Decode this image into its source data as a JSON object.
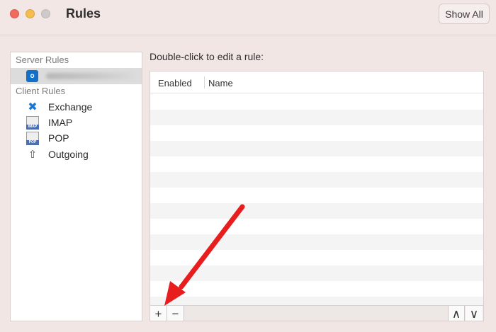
{
  "window": {
    "title": "Rules",
    "show_all_label": "Show All"
  },
  "sidebar": {
    "server_rules_label": "Server Rules",
    "client_rules_label": "Client Rules",
    "client_items": [
      {
        "label": "Exchange",
        "icon": "exchange-icon"
      },
      {
        "label": "IMAP",
        "icon": "imap-icon"
      },
      {
        "label": "POP",
        "icon": "pop-icon"
      },
      {
        "label": "Outgoing",
        "icon": "outgoing-icon"
      }
    ]
  },
  "main": {
    "instruction": "Double-click to edit a rule:",
    "columns": [
      "Enabled",
      "Name"
    ],
    "toolbar": {
      "add_label": "+",
      "remove_label": "−",
      "up_label": "∧",
      "down_label": "∨"
    }
  },
  "colors": {
    "annotation_arrow": "#e81d1d",
    "accent": "#1170c7"
  }
}
